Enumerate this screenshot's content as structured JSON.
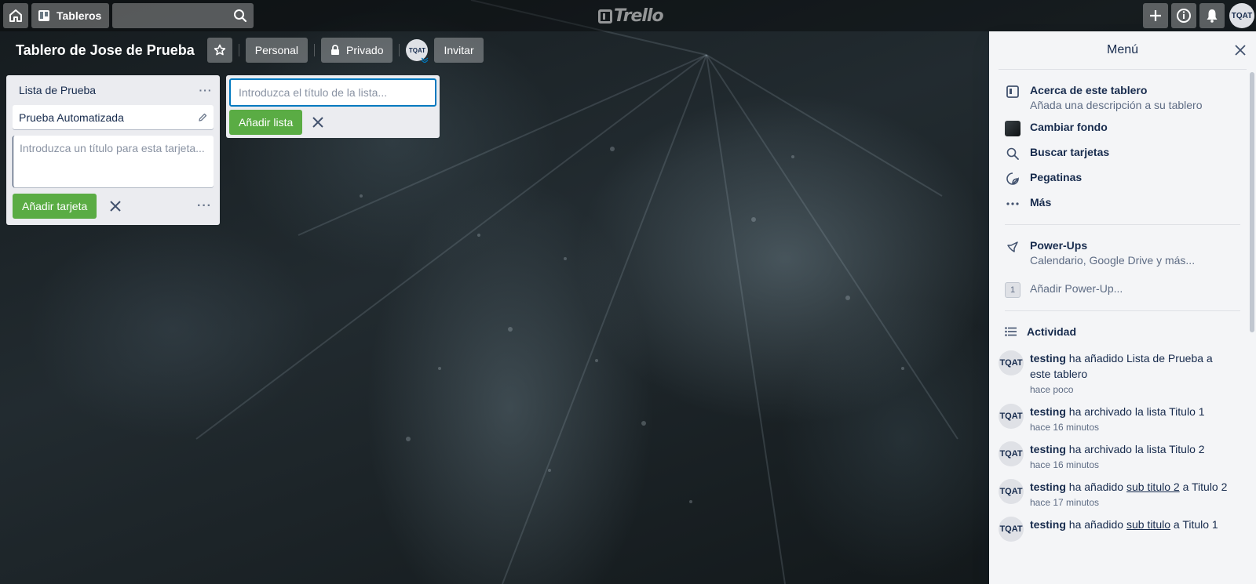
{
  "header": {
    "boards_label": "Tableros",
    "logo_text": "Trello",
    "avatar": "TQAT"
  },
  "board": {
    "title": "Tablero de Jose de Prueba",
    "team_label": "Personal",
    "visibility_label": "Privado",
    "member_avatar": "TQAT",
    "invite_label": "Invitar"
  },
  "list": {
    "title": "Lista de Prueba",
    "menu": "···",
    "cards": [
      {
        "title": "Prueba Automatizada"
      }
    ],
    "composer_placeholder": "Introduzca un título para esta tarjeta...",
    "add_card_label": "Añadir tarjeta"
  },
  "add_list": {
    "placeholder": "Introduzca el título de la lista...",
    "button_label": "Añadir lista"
  },
  "menu": {
    "title": "Menú",
    "items": [
      {
        "title": "Acerca de este tablero",
        "subtitle": "Añada una descripción a su tablero"
      },
      {
        "title": "Cambiar fondo"
      },
      {
        "title": "Buscar tarjetas"
      },
      {
        "title": "Pegatinas"
      },
      {
        "title": "Más"
      }
    ],
    "powerups": {
      "title": "Power-Ups",
      "subtitle": "Calendario, Google Drive y más...",
      "count": "1",
      "add_label": "Añadir Power-Up..."
    },
    "activity": {
      "title": "Actividad",
      "entries": [
        {
          "avatar": "TQAT",
          "user": "testing",
          "text_pre": " ha añadido Lista de Prueba a este tablero",
          "link": "",
          "text_post": "",
          "time": "hace poco"
        },
        {
          "avatar": "TQAT",
          "user": "testing",
          "text_pre": " ha archivado la lista Titulo 1",
          "link": "",
          "text_post": "",
          "time": "hace 16 minutos"
        },
        {
          "avatar": "TQAT",
          "user": "testing",
          "text_pre": " ha archivado la lista Titulo 2",
          "link": "",
          "text_post": "",
          "time": "hace 16 minutos"
        },
        {
          "avatar": "TQAT",
          "user": "testing",
          "text_pre": " ha añadido ",
          "link": "sub titulo 2",
          "text_post": " a Titulo 2",
          "time": "hace 17 minutos"
        },
        {
          "avatar": "TQAT",
          "user": "testing",
          "text_pre": " ha añadido ",
          "link": "sub titulo",
          "text_post": " a Titulo 1",
          "time": ""
        }
      ]
    }
  },
  "colors": {
    "accent_green": "#5aac44",
    "focus_blue": "#0079bf",
    "list_bg": "#ebecf0",
    "menu_bg": "#f4f5f7"
  }
}
